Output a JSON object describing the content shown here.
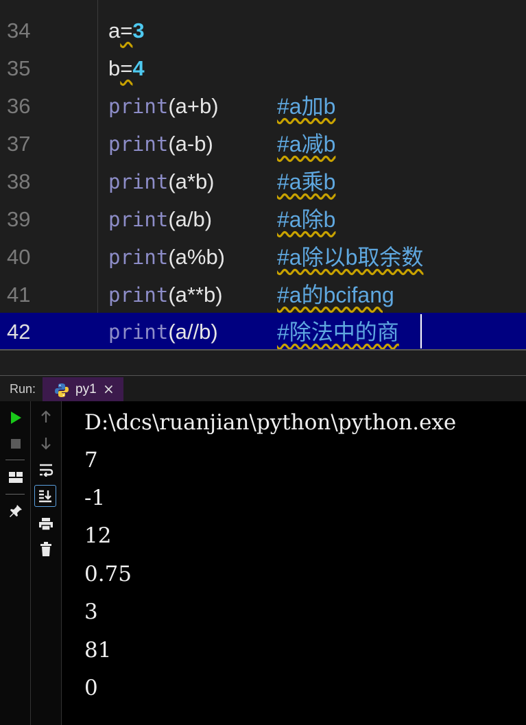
{
  "editor": {
    "lines": [
      {
        "num": "34",
        "pre": "a",
        "op": "=",
        "val": "3"
      },
      {
        "num": "35",
        "pre": "b",
        "op": "=",
        "val": "4"
      },
      {
        "num": "36",
        "kw": "print",
        "args": "(a+b)",
        "comment": "#a加b"
      },
      {
        "num": "37",
        "kw": "print",
        "args": "(a-b)",
        "comment": "#a减b"
      },
      {
        "num": "38",
        "kw": "print",
        "args": "(a*b)",
        "comment": "#a乘b"
      },
      {
        "num": "39",
        "kw": "print",
        "args": "(a/b)",
        "comment": "#a除b"
      },
      {
        "num": "40",
        "kw": "print",
        "args": "(a%b)",
        "comment": "#a除以b取余数"
      },
      {
        "num": "41",
        "kw": "print",
        "args": "(a**b)",
        "comment": "#a的bcifang"
      },
      {
        "num": "42",
        "kw": "print",
        "args": "(a//b)",
        "comment": "#除法中的商"
      }
    ]
  },
  "run": {
    "label": "Run:",
    "tab": {
      "label": "py1",
      "close": "×"
    }
  },
  "toolbar": {
    "run_icon": "play-icon",
    "stop_icon": "stop-icon",
    "layout_icon": "layout-icon",
    "pin_icon": "pin-icon",
    "up_icon": "arrow-up-icon",
    "down_icon": "arrow-down-icon",
    "wrap_icon": "soft-wrap-icon",
    "scroll_icon": "scroll-to-end-icon",
    "print_icon": "print-icon",
    "trash_icon": "trash-icon"
  },
  "console": {
    "lines": [
      "D:\\dcs\\ruanjian\\python\\python.exe",
      "7",
      "-1",
      "12",
      "0.75",
      "3",
      "81",
      "0"
    ]
  },
  "colors": {
    "current_line": "#000080",
    "keyword": "#8d8dc8",
    "number": "#4ec9f0",
    "comment": "#5fa8e0",
    "tab_bg": "#3c1a4c",
    "run_green": "#19c819"
  }
}
